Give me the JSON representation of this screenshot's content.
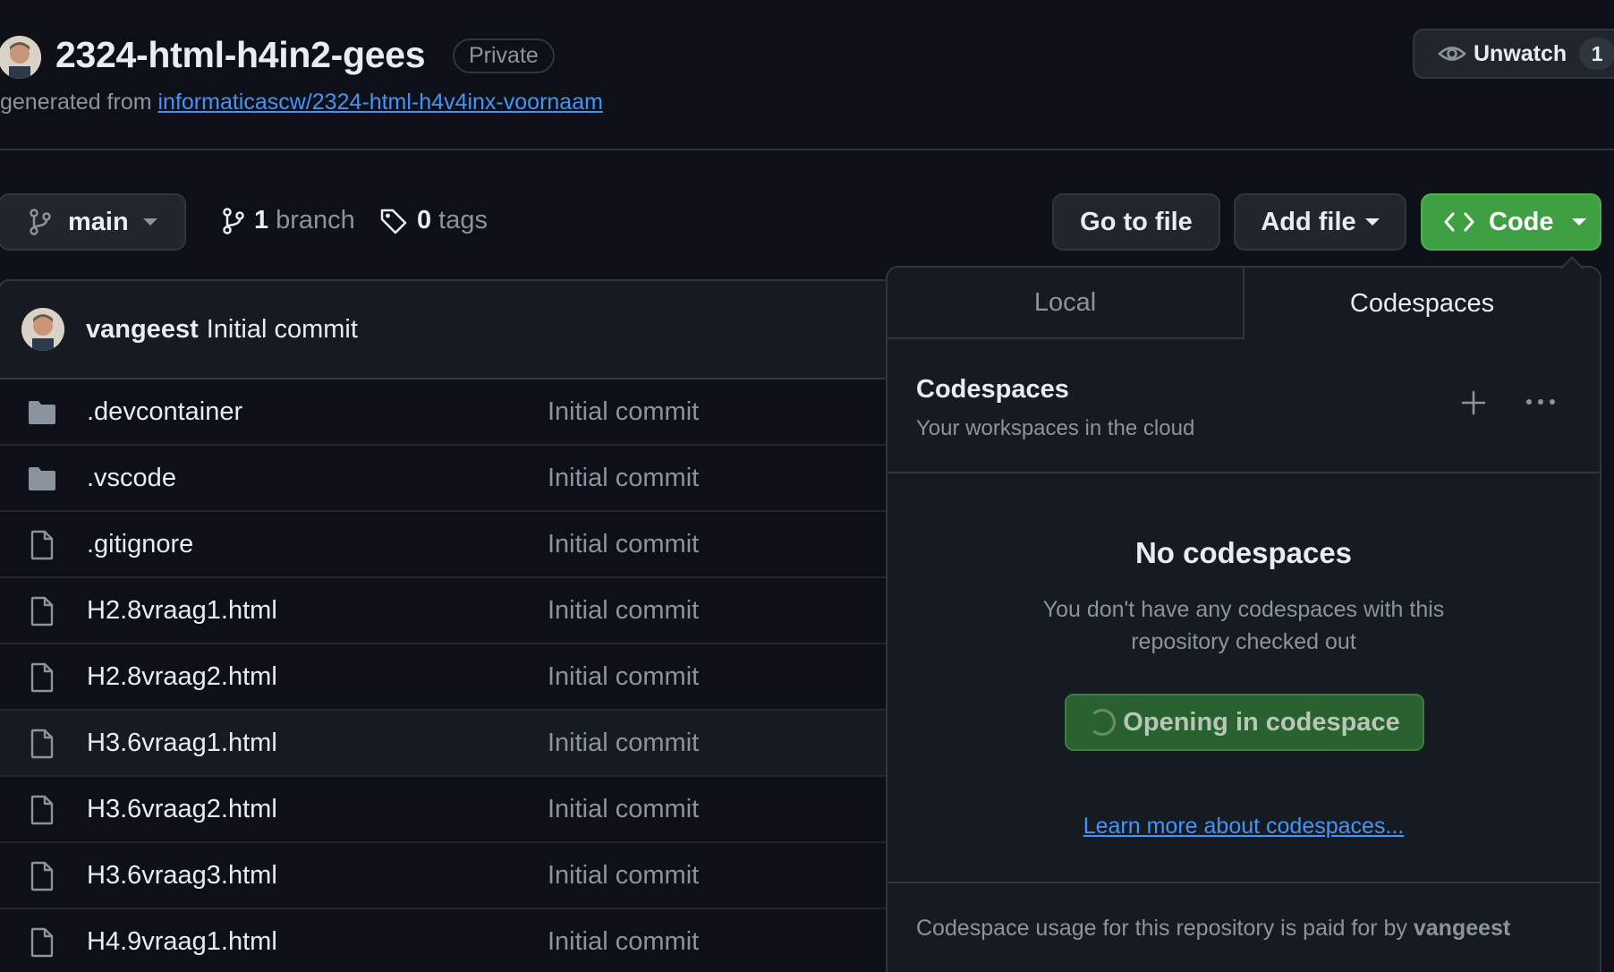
{
  "repo": {
    "name": "2324-html-h4in2-gees",
    "visibility": "Private",
    "generated_prefix": "generated from",
    "template_link": "informaticascw/2324-html-h4v4inx-voornaam"
  },
  "watch": {
    "label": "Unwatch",
    "count": "1"
  },
  "toolbar": {
    "branch": "main",
    "branch_count": "1",
    "branch_word": "branch",
    "tag_count": "0",
    "tag_word": "tags",
    "go_to_file": "Go to file",
    "add_file": "Add file",
    "code": "Code"
  },
  "latest_commit": {
    "author": "vangeest",
    "message": "Initial commit"
  },
  "files": [
    {
      "name": ".devcontainer",
      "type": "folder",
      "commit": "Initial commit"
    },
    {
      "name": ".vscode",
      "type": "folder",
      "commit": "Initial commit"
    },
    {
      "name": ".gitignore",
      "type": "file",
      "commit": "Initial commit"
    },
    {
      "name": "H2.8vraag1.html",
      "type": "file",
      "commit": "Initial commit"
    },
    {
      "name": "H2.8vraag2.html",
      "type": "file",
      "commit": "Initial commit"
    },
    {
      "name": "H3.6vraag1.html",
      "type": "file",
      "commit": "Initial commit"
    },
    {
      "name": "H3.6vraag2.html",
      "type": "file",
      "commit": "Initial commit"
    },
    {
      "name": "H3.6vraag3.html",
      "type": "file",
      "commit": "Initial commit"
    },
    {
      "name": "H4.9vraag1.html",
      "type": "file",
      "commit": "Initial commit"
    }
  ],
  "code_dropdown": {
    "tabs": [
      "Local",
      "Codespaces"
    ],
    "active_tab": "Codespaces",
    "title": "Codespaces",
    "subtitle": "Your workspaces in the cloud",
    "empty_title": "No codespaces",
    "empty_text": "You don't have any codespaces with this repository checked out",
    "open_button": "Opening in codespace",
    "learn_more": "Learn more about codespaces...",
    "footer_prefix": "Codespace usage for this repository is paid for by",
    "footer_owner": "vangeest"
  },
  "colors": {
    "background": "#0d1117",
    "accent_green": "#3fa043",
    "link_blue": "#4493f8"
  }
}
